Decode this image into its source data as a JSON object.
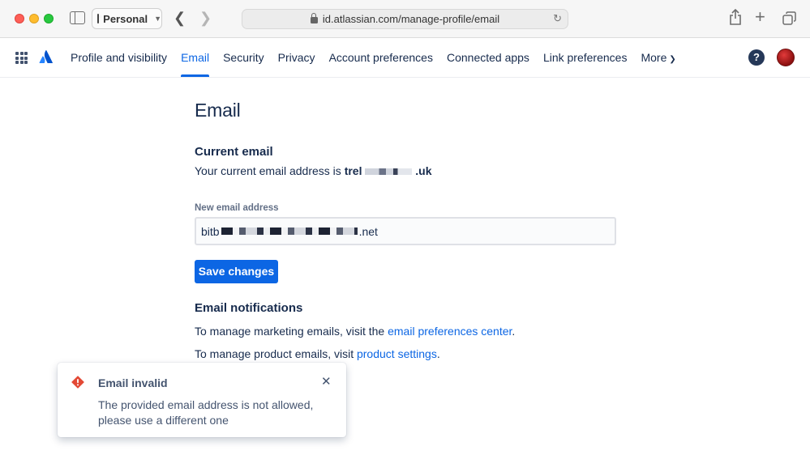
{
  "browser": {
    "profile_label": "Personal",
    "url": "id.atlassian.com/manage-profile/email"
  },
  "nav": {
    "items": [
      {
        "label": "Profile and visibility",
        "active": false
      },
      {
        "label": "Email",
        "active": true
      },
      {
        "label": "Security",
        "active": false
      },
      {
        "label": "Privacy",
        "active": false
      },
      {
        "label": "Account preferences",
        "active": false
      },
      {
        "label": "Connected apps",
        "active": false
      },
      {
        "label": "Link preferences",
        "active": false
      }
    ],
    "more_label": "More",
    "help_glyph": "?"
  },
  "page": {
    "title": "Email",
    "current_email": {
      "heading": "Current email",
      "prefix": "Your current email address is ",
      "email_start": "trel",
      "email_end": ".uk"
    },
    "new_email": {
      "label": "New email address",
      "value_start": "bitb",
      "value_end": ".net"
    },
    "save_label": "Save changes",
    "notifications": {
      "heading": "Email notifications",
      "line1_prefix": "To manage marketing emails, visit the ",
      "line1_link": "email preferences center",
      "line1_suffix": ".",
      "line2_prefix": "To manage product emails, visit ",
      "line2_link": "product settings",
      "line2_suffix": "."
    }
  },
  "flag": {
    "title": "Email invalid",
    "body": "The provided email address is not allowed, please use a different one",
    "icon": "error-icon",
    "color": "#e34935"
  },
  "colors": {
    "accent": "#0c66e4",
    "text": "#172b4d"
  }
}
